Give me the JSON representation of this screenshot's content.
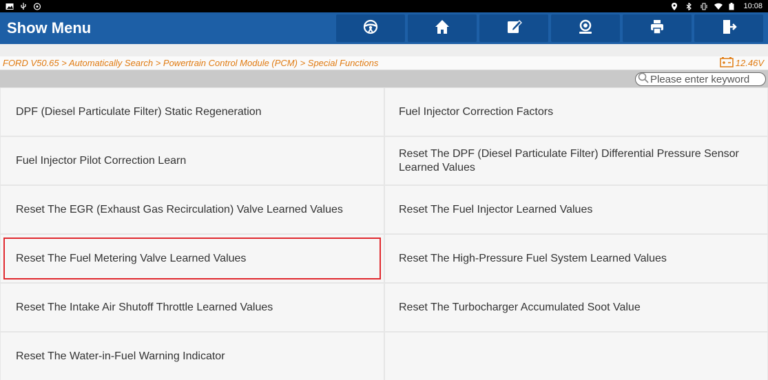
{
  "status_bar": {
    "time": "10:08"
  },
  "header": {
    "title": "Show Menu",
    "buttons": [
      {
        "name": "vehicle-button",
        "icon": "steering-wheel-icon"
      },
      {
        "name": "home-button",
        "icon": "home-icon"
      },
      {
        "name": "edit-button",
        "icon": "edit-icon"
      },
      {
        "name": "support-button",
        "icon": "support-icon"
      },
      {
        "name": "print-button",
        "icon": "printer-icon"
      },
      {
        "name": "exit-button",
        "icon": "exit-icon"
      }
    ]
  },
  "breadcrumb": {
    "path": "FORD V50.65 > Automatically Search > Powertrain Control Module (PCM) > Special Functions",
    "voltage": "12.46V"
  },
  "search": {
    "placeholder": "Please enter keyword"
  },
  "functions": [
    "DPF (Diesel Particulate Filter) Static Regeneration",
    "Fuel Injector Correction Factors",
    "Fuel Injector Pilot Correction Learn",
    "Reset The DPF (Diesel Particulate Filter) Differential Pressure Sensor Learned Values",
    "Reset The EGR (Exhaust Gas Recirculation) Valve Learned Values",
    "Reset The Fuel Injector Learned Values",
    "Reset The Fuel Metering Valve Learned Values",
    "Reset The High-Pressure Fuel System Learned Values",
    "Reset The Intake Air Shutoff Throttle Learned Values",
    "Reset The Turbocharger Accumulated Soot Value",
    "Reset The Water-in-Fuel Warning Indicator"
  ],
  "selected_index": 6,
  "colors": {
    "header": "#1d5fa6",
    "accent": "#e07a10",
    "highlight": "#e0282e"
  }
}
